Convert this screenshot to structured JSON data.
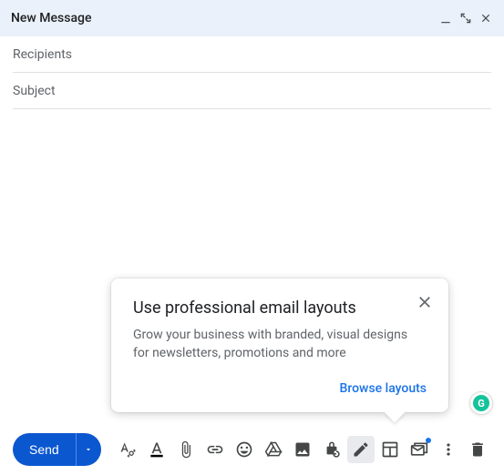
{
  "header": {
    "title": "New Message"
  },
  "fields": {
    "recipients": "Recipients",
    "subject": "Subject"
  },
  "tooltip": {
    "title": "Use professional email layouts",
    "body": "Grow your business with branded, visual designs for newsletters, promotions and more",
    "action": "Browse layouts"
  },
  "toolbar": {
    "send": "Send"
  },
  "grammarly": {
    "label": "G"
  }
}
